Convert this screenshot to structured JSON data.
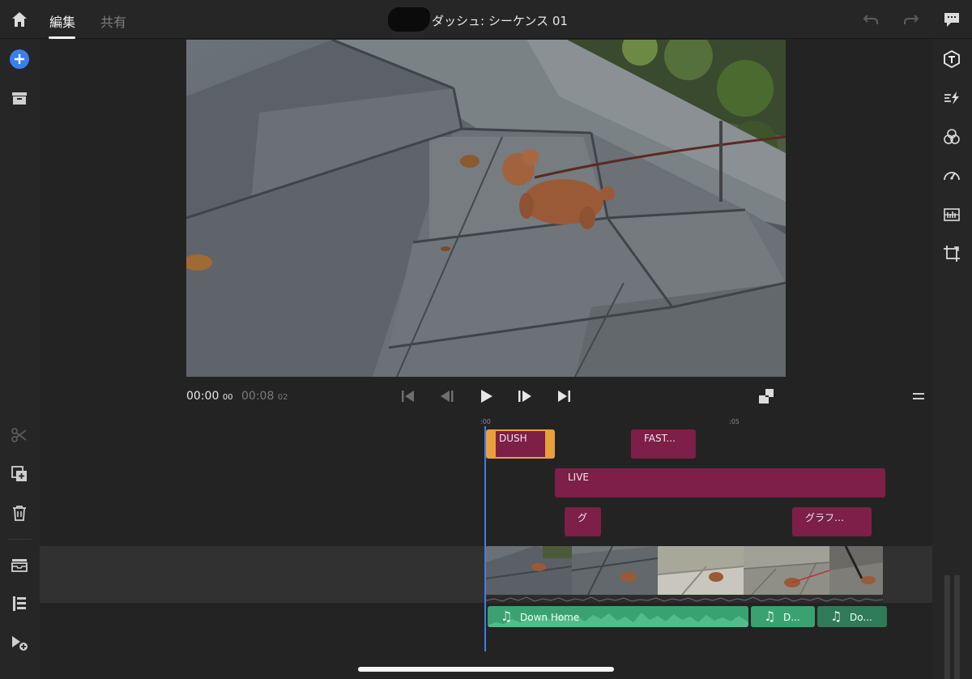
{
  "header": {
    "tabs": [
      {
        "label": "編集",
        "active": true
      },
      {
        "label": "共有",
        "active": false
      }
    ],
    "sequence_title": "ダッシュ: シーケンス 01"
  },
  "left_rail": {
    "icons": [
      "add-icon",
      "media-bin-icon",
      "split-icon",
      "duplicate-icon",
      "trash-icon",
      "tray-icon",
      "outline-list-icon",
      "add-clip-icon"
    ],
    "accent": "#3a7ff0"
  },
  "right_rail": {
    "icons": [
      "title-text-icon",
      "transition-icon",
      "color-icon",
      "speed-icon",
      "audio-levels-icon",
      "crop-icon"
    ]
  },
  "player": {
    "current_time": "00:00",
    "current_frames": "00",
    "total_time": "00:08",
    "total_frames": "02"
  },
  "timeline": {
    "ruler": {
      "start": ":00",
      "mark_5": ":05"
    },
    "title_clips": [
      {
        "label": "DUSH",
        "selected": true
      },
      {
        "label": "FAST..."
      },
      {
        "label": "LIVE"
      },
      {
        "label": "グ"
      },
      {
        "label": "グラフ…"
      }
    ],
    "audio_clips": [
      {
        "label": "Down Home"
      },
      {
        "label": "D..."
      },
      {
        "label": "Do..."
      }
    ],
    "colors": {
      "title_clip": "#7d1f46",
      "selected_border": "#e8a03a",
      "audio_clip": "#3aa271",
      "playhead": "#3d7df0"
    }
  }
}
